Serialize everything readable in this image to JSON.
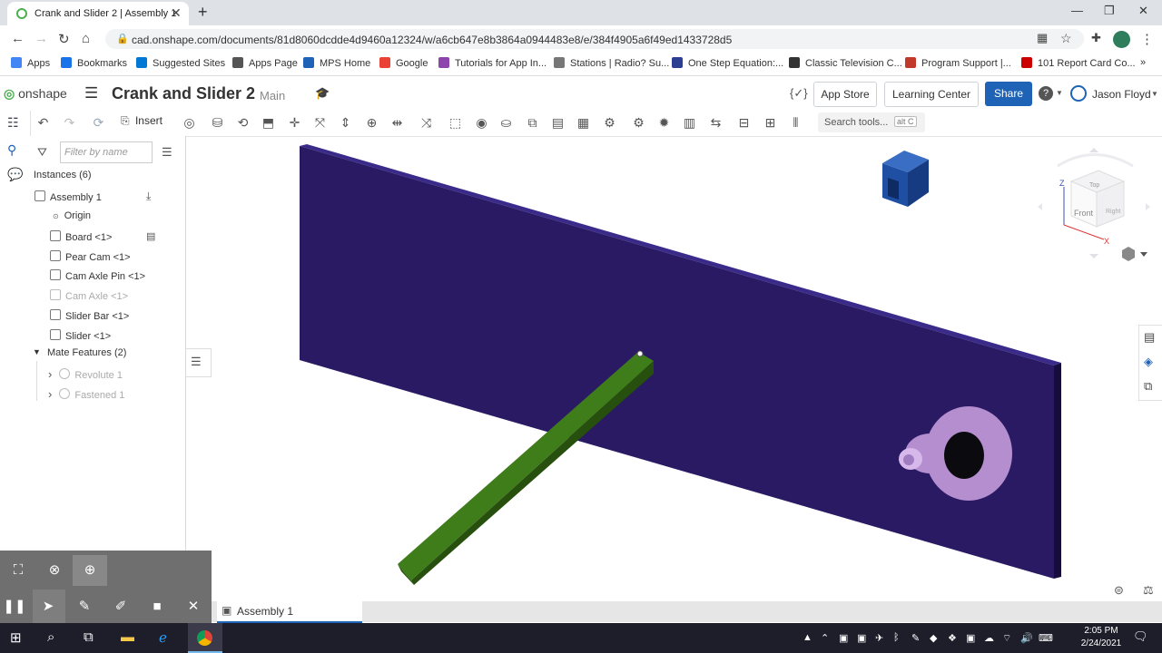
{
  "browser": {
    "tab_title": "Crank and Slider 2 | Assembly 1",
    "tab_close": "✕",
    "new_tab": "+",
    "url": "cad.onshape.com/documents/81d8060dcdde4d9460a12324/w/a6cb647e8b3864a0944483e8/e/384f4905a6f49ed1433728d5",
    "window_controls": [
      "—",
      "❐",
      "✕"
    ],
    "bookmarks": [
      {
        "label": "Apps",
        "color": "#4285f4"
      },
      {
        "label": "Bookmarks",
        "color": "#1a73e8"
      },
      {
        "label": "Suggested Sites",
        "color": "#0078d4"
      },
      {
        "label": "Apps Page",
        "color": "#555555"
      },
      {
        "label": "MPS Home",
        "color": "#1e63b5"
      },
      {
        "label": "Google",
        "color": "#ea4335"
      },
      {
        "label": "Tutorials for App In...",
        "color": "#8e44ad"
      },
      {
        "label": "Stations | Radio? Su...",
        "color": "#777777"
      },
      {
        "label": "One Step Equation:...",
        "color": "#2c3e91"
      },
      {
        "label": "Classic Television C...",
        "color": "#333333"
      },
      {
        "label": "Program Support |...",
        "color": "#c0392b"
      },
      {
        "label": "101 Report Card Co...",
        "color": "#cc0000"
      }
    ]
  },
  "header": {
    "logo": "onshape",
    "title": "Crank and Slider 2",
    "subtitle": "Main",
    "app_store": "App Store",
    "learning_center": "Learning Center",
    "share": "Share",
    "help": "?",
    "user": "Jason Floyd",
    "code_icon": "{✓}"
  },
  "toolbar": {
    "insert": "Insert",
    "search_tools": "Search tools...",
    "search_shortcut": "alt C"
  },
  "panel": {
    "filter_placeholder": "Filter by name",
    "instances_header": "Instances (6)",
    "assembly": "Assembly 1",
    "origin": "Origin",
    "instances": [
      {
        "label": "Board <1>",
        "dim": false
      },
      {
        "label": "Pear Cam <1>",
        "dim": false
      },
      {
        "label": "Cam Axle Pin <1>",
        "dim": false
      },
      {
        "label": "Cam Axle <1>",
        "dim": true
      },
      {
        "label": "Slider Bar <1>",
        "dim": false
      },
      {
        "label": "Slider <1>",
        "dim": false
      }
    ],
    "mates_header": "Mate Features (2)",
    "mates": [
      "Revolute 1",
      "Fastened 1"
    ]
  },
  "viewcube": {
    "top": "Top",
    "front": "Front",
    "right": "Right",
    "z": "Z",
    "x": "X"
  },
  "tabs": {
    "assembly_tab": "Assembly 1"
  },
  "colors": {
    "board": "#2a1a63",
    "board_top": "#3a2a8a",
    "slider_bar": "#3e7d1a",
    "cam": "#b58ed0",
    "slider": "#1f4fa3",
    "accent": "#1e63b5"
  },
  "taskbar": {
    "time": "2:05 PM",
    "date": "2/24/2021"
  }
}
